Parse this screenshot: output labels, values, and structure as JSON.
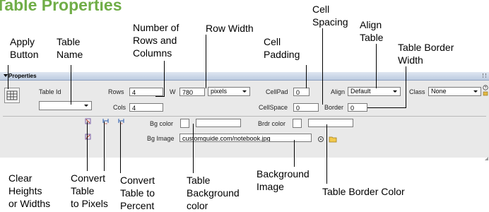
{
  "page": {
    "title": "Table Properties"
  },
  "callouts": {
    "apply_button": "Apply\nButton",
    "table_name": "Table\nName",
    "rows_columns": "Number of\nRows and\nColumns",
    "row_width": "Row Width",
    "cell_spacing": "Cell\nSpacing",
    "cell_padding": "Cell\nPadding",
    "align_table": "Align\nTable",
    "table_border_width": "Table Border\nWidth",
    "clear_heights": "Clear\nHeights\nor Widths",
    "convert_pixels": "Convert\nTable\nto Pixels",
    "convert_percent": "Convert\nTable to\nPercent",
    "table_bg_color": "Table\nBackground\ncolor",
    "background_image": "Background\nImage",
    "table_border_color": "Table Border Color"
  },
  "panel": {
    "header": "Properties",
    "table_id_label": "Table Id",
    "table_id_value": "",
    "rows_label": "Rows",
    "rows_value": "4",
    "cols_label": "Cols",
    "cols_value": "4",
    "w_label": "W",
    "w_value": "780",
    "w_unit": "pixels",
    "cellpad_label": "CellPad",
    "cellpad_value": "0",
    "cellspace_label": "CellSpace",
    "cellspace_value": "0",
    "align_label": "Align",
    "align_value": "Default",
    "border_label": "Border",
    "border_value": "0",
    "class_label": "Class",
    "class_value": "None",
    "bgcolor_label": "Bg color",
    "bgcolor_value": "",
    "brdrcolor_label": "Brdr color",
    "brdrcolor_value": "",
    "bgimage_label": "Bg Image",
    "bgimage_value": "customguide.com/notebook.jpg"
  },
  "icons": {
    "apply": "table-icon",
    "clear_heights": "clear-heights-icon",
    "clear_widths": "clear-widths-icon",
    "convert_pixels": "convert-to-pixels-icon",
    "convert_percent": "convert-to-percent-icon",
    "point_to_file": "point-to-file-icon",
    "browse_folder": "folder-icon",
    "help": "help-icon"
  }
}
